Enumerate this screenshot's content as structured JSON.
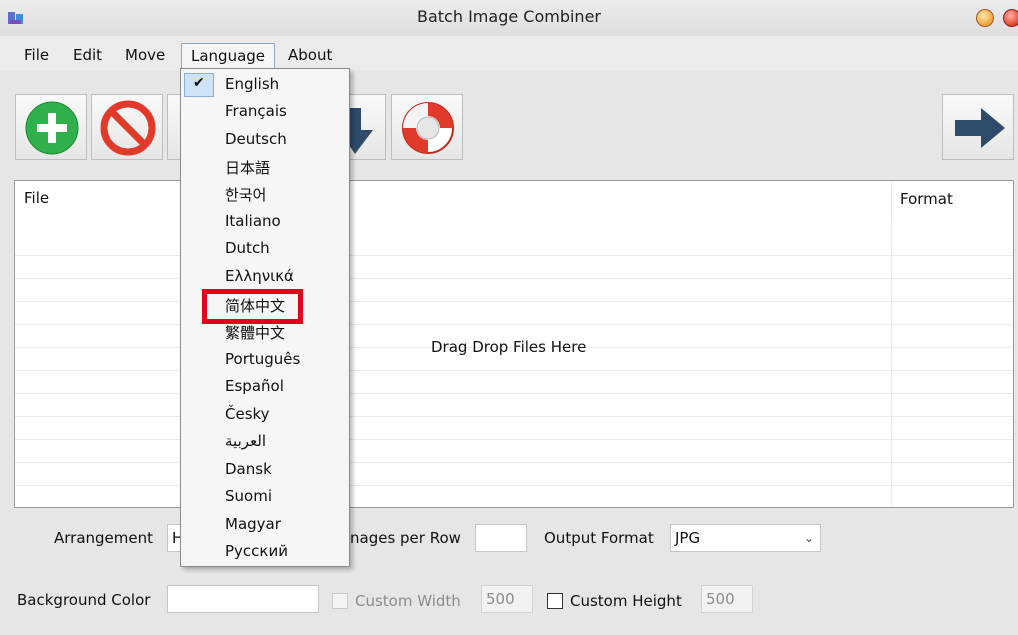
{
  "window": {
    "title": "Batch Image Combiner"
  },
  "menubar": {
    "items": [
      "File",
      "Edit",
      "Move",
      "Language",
      "About"
    ]
  },
  "filelist": {
    "columns": [
      "File",
      "Format"
    ],
    "drop_hint": "Drag  Drop Files Here"
  },
  "language_menu": {
    "selected": "English",
    "items": [
      "English",
      "Français",
      "Deutsch",
      "日本語",
      "한국어",
      "Italiano",
      "Dutch",
      "Ελληνικά",
      "简体中文",
      "繁體中文",
      "Português",
      "Español",
      "Česky",
      "العربية",
      "Dansk",
      "Suomi",
      "Magyar",
      "Русский"
    ]
  },
  "settings": {
    "arrangement_label": "Arrangement",
    "arrangement_value": "H",
    "images_per_row_label": "nages per Row",
    "images_per_row_value": "",
    "output_format_label": "Output Format",
    "output_format_value": "JPG",
    "background_color_label": "Background Color",
    "custom_width_label": "Custom Width",
    "custom_width_value": "500",
    "custom_height_label": "Custom Height",
    "custom_height_value": "500"
  },
  "colors": {
    "highlight": "#e2001a",
    "add_icon": "#2fb04a",
    "remove_icon": "#e23a2a",
    "arrow_icon": "#2e4b6a"
  }
}
